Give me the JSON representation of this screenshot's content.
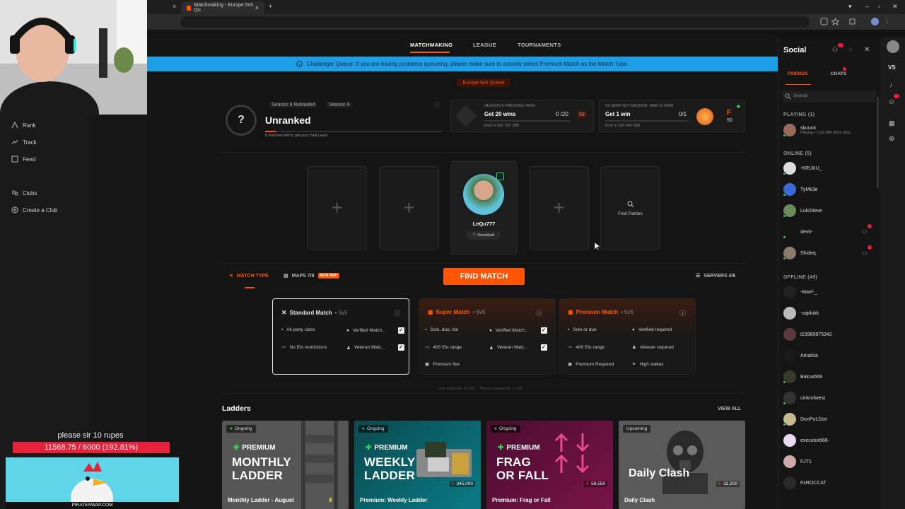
{
  "browser": {
    "active_tab": "Matchmaking - Europe 5v5 Qu",
    "new_tab": "+",
    "close": "×"
  },
  "left_nav": {
    "items": [
      {
        "label": "Rank",
        "icon": "rank-icon"
      },
      {
        "label": "Track",
        "icon": "track-icon"
      },
      {
        "label": "Feed",
        "icon": "feed-icon"
      },
      {
        "label": "Clubs",
        "icon": "clubs-icon"
      },
      {
        "label": "Create a Club",
        "icon": "plus-circle-icon"
      }
    ]
  },
  "top_nav": {
    "tabs": [
      "MATCHMAKING",
      "LEAGUE",
      "TOURNAMENTS"
    ],
    "active": "MATCHMAKING"
  },
  "banner": "Challenger Queue: If you are having problems queueing, please make sure to actively select Premium Match as the Match Type.",
  "queue_label": "Europe 5v5 Queue",
  "rank": {
    "season_a": "Season 8 Reloaded",
    "season_b": "Season 9",
    "title": "Unranked",
    "sub": "8 matches left to get your Skill Level",
    "progress": 0.06
  },
  "prestige": {
    "label": "SEASON 9 PRESTIGE PATH",
    "goal": "Get 20 wins",
    "count": "0 /20",
    "ends": "Ends in 90D 16H 35M",
    "badge": "59"
  },
  "mission": {
    "label": "S9 MONTHLY MISSION: MAN-O'-WAR",
    "goal": "Get 1 win",
    "count": "0/1",
    "ends": "Ends in 25D 04H 35M",
    "reward": "50"
  },
  "party": {
    "player_name": "LeQu777",
    "player_rank": "Unranked",
    "find_parties": "Find Parties"
  },
  "matchbar": {
    "match_type": "MATCH TYPE",
    "maps": "MAPS 7/8",
    "new_map": "NEW MAP",
    "find": "FIND MATCH",
    "servers": "SERVERS 4/6"
  },
  "match_types": [
    {
      "title": "Standard Match",
      "size": "• 5v5",
      "rows": [
        "All party sizes",
        "Verified Match...",
        "No Elo restrictions",
        "Veteran Matc..."
      ]
    },
    {
      "title": "Super Match",
      "size": "• 5v5",
      "rows": [
        "Solo, duo, trio",
        "Verified Match...",
        "400 Elo range",
        "Veteran Matc...",
        "Premium flex"
      ]
    },
    {
      "title": "Premium Match",
      "size": "• 5v5",
      "rows": [
        "Solo or duo",
        "Verified required",
        "400 Elo range",
        "Veteran required",
        "Premium Required",
        "High stakes"
      ]
    }
  ],
  "live": "Live matches: 10,391    Players queueing: 1,158",
  "ladders": {
    "heading": "Ladders",
    "view_all": "VIEW ALL",
    "items": [
      {
        "status": "Ongoing",
        "tag": "PREMIUM",
        "big1": "MONTHLY",
        "big2": "LADDER",
        "prize": "",
        "name": "Monthly Ladder - August"
      },
      {
        "status": "Ongoing",
        "tag": "PREMIUM",
        "big1": "WEEKLY",
        "big2": "LADDER",
        "prize": "345,000",
        "name": "Premium: Weekly Ladder"
      },
      {
        "status": "Ongoing",
        "tag": "PREMIUM",
        "big1": "FRAG",
        "big2": "OR FALL",
        "prize": "58,550",
        "name": "Premium: Frag or Fall"
      },
      {
        "status": "Upcoming",
        "tag": "",
        "big1": "Daily Clash",
        "big2": "",
        "prize": "32,200",
        "name": "Daily Clash"
      }
    ]
  },
  "social": {
    "title": "Social",
    "tabs": [
      "FRIENDS",
      "CHATS"
    ],
    "search_placeholder": "Search",
    "playing_header": "PLAYING (1)",
    "playing": [
      {
        "name": "skuunk",
        "status": "Playing • CS2 MM (05m 05s)"
      }
    ],
    "online_header": "ONLINE (5)",
    "online": [
      "-KRUKU_",
      "TyMk3e",
      "LukiSteve",
      "dev0-",
      "Shideq"
    ],
    "offline_header": "OFFLINE (49)",
    "offline": [
      "-Mael-_",
      "-sajdukk",
      "t23960875342",
      "Amalcia",
      "Bakus666",
      "cinkrofwest",
      "DonPoLDon",
      "executor666-",
      "FJT1",
      "FxROCCAT"
    ]
  },
  "overlay": {
    "donate_text": "please sir 10 rupes",
    "donate_bar": "11568.75 / 6000 (192.81%)",
    "url": "PIRATESWAP.COM",
    "stream_tag": "VS"
  },
  "colors": {
    "accent": "#ff5500",
    "banner": "#1d9fe8",
    "online": "#39d353"
  }
}
